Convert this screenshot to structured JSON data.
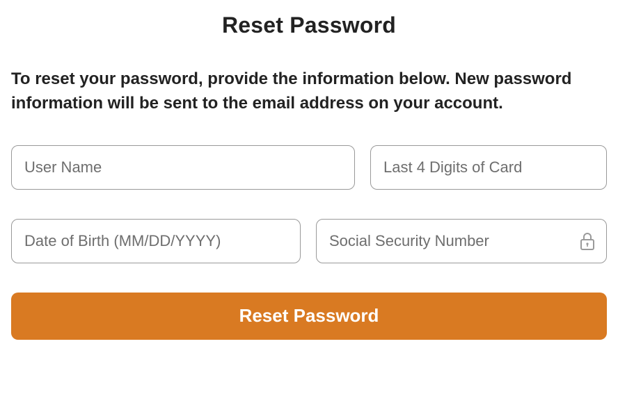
{
  "title": "Reset Password",
  "instructions": "To reset your password, provide the information below. New password information will be sent to the email address on your account.",
  "fields": {
    "username": {
      "placeholder": "User Name",
      "value": ""
    },
    "cardLast4": {
      "placeholder": "Last 4 Digits of Card",
      "value": ""
    },
    "dob": {
      "placeholder": "Date of Birth (MM/DD/YYYY)",
      "value": ""
    },
    "ssn": {
      "placeholder": "Social Security Number",
      "value": ""
    }
  },
  "submitLabel": "Reset Password",
  "colors": {
    "accent": "#d97a22"
  }
}
